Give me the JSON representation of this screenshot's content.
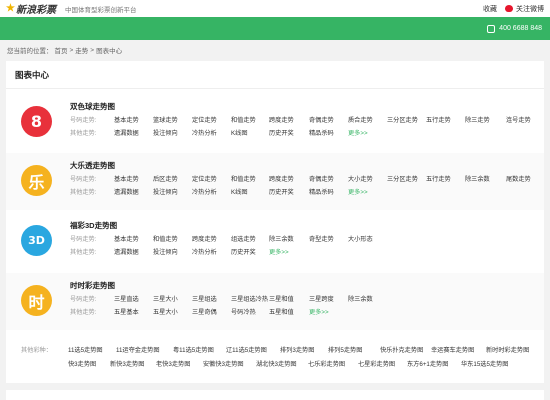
{
  "top": {
    "logo": "新浪彩票",
    "tagline": "中国体育型彩票创新平台",
    "favorite": "收藏",
    "weibo": "关注微博"
  },
  "green": {
    "phone": "400 6688 848"
  },
  "breadcrumb": {
    "prefix": "您当前的位置：",
    "home": "首页",
    "trend": "走势",
    "current": "图表中心",
    "sep": ">"
  },
  "panel": {
    "title": "图表中心"
  },
  "line_labels": {
    "number": "号码走势:",
    "other": "其他走势:"
  },
  "more": "更多>>",
  "games": [
    {
      "name": "双色球走势图",
      "badge": "8",
      "color": "#e8313b",
      "row1": [
        "基本走势",
        "篮球走势",
        "定位走势",
        "和值走势",
        "跨度走势",
        "奇偶走势",
        "质合走势",
        "三分区走势",
        "五行走势",
        "除三走势",
        "连号走势"
      ],
      "row2": [
        "遗漏数据",
        "投注倾向",
        "冷热分析",
        "K线图",
        "历史开奖",
        "精品杀码"
      ]
    },
    {
      "name": "大乐透走势图",
      "badge": "乐",
      "color": "#f5b21f",
      "row1": [
        "基本走势",
        "后区走势",
        "定位走势",
        "和值走势",
        "跨度走势",
        "奇偶走势",
        "大小走势",
        "三分区走势",
        "五行走势",
        "除三余数",
        "尾数走势"
      ],
      "row2": [
        "遗漏数据",
        "投注倾向",
        "冷热分析",
        "K线图",
        "历史开奖",
        "精品杀码"
      ]
    },
    {
      "name": "福彩3D走势图",
      "badge": "3D",
      "color": "#2aa7e0",
      "row1": [
        "基本走势",
        "和值走势",
        "跨度走势",
        "组选走势",
        "除三余数",
        "奇型走势",
        "大小形态"
      ],
      "row2": [
        "遗漏数据",
        "投注倾向",
        "冷热分析",
        "历史开奖"
      ]
    },
    {
      "name": "时时彩走势图",
      "badge": "时",
      "color": "#f5b21f",
      "row1": [
        "三星直选",
        "三星大小",
        "三星组选",
        "三星组选冷热",
        "三星和值",
        "三星跨度",
        "除三余数"
      ],
      "row2": [
        "五星基本",
        "五星大小",
        "三星奇偶",
        "号码冷热",
        "五星和值"
      ]
    }
  ],
  "others": {
    "label": "其他彩种：",
    "row1": [
      "11选5走势图",
      "11运夺金走势图",
      "粤11选5走势图",
      "辽11选5走势图",
      "排列3走势图",
      "排列5走势图",
      "快乐扑克走势图",
      "幸运赛车走势图",
      "新时时彩走势图"
    ],
    "row2": [
      "快3走势图",
      "新快3走势图",
      "老快3走势图",
      "安徽快3走势图",
      "湖北快3走势图",
      "七乐彩走势图",
      "七星彩走势图",
      "东方6+1走势图",
      "华东15选5走势图"
    ]
  }
}
